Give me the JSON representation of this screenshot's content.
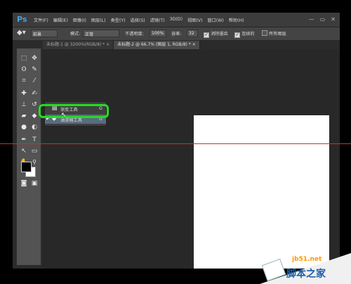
{
  "app": {
    "logo": "Ps"
  },
  "menu": [
    "文件(F)",
    "编辑(E)",
    "图像(I)",
    "图层(L)",
    "类型(Y)",
    "选择(S)",
    "滤镜(T)",
    "3D(D)",
    "视图(V)",
    "窗口(W)",
    "帮助(H)"
  ],
  "window_controls": {
    "minimize": "—",
    "restore": "▭",
    "close": "✕"
  },
  "options": {
    "tool_icon": "paint-bucket-icon",
    "fill_source": "前景",
    "mode_label": "模式:",
    "mode_value": "正常",
    "opacity_label": "不透明度:",
    "opacity_value": "100%",
    "tolerance_label": "容差:",
    "tolerance_value": "32",
    "antialias_label": "消除锯齿",
    "contiguous_label": "连续的",
    "all_layers_label": "所有图层"
  },
  "tabs": [
    {
      "label": "未标题-1 @ 3200%(RGB/8) *",
      "close": "×"
    },
    {
      "label": "未标题-2 @ 66.7% (图层 1, RGB/8) *",
      "close": "×"
    }
  ],
  "flyout": {
    "items": [
      {
        "label": "渐变工具",
        "shortcut": "G",
        "icon": "gradient-icon"
      },
      {
        "label": "油漆桶工具",
        "shortcut": "G",
        "icon": "paint-bucket-icon"
      }
    ]
  },
  "tools": {
    "marquee": "⬚",
    "move": "✥",
    "lasso": "ʘ",
    "quick_select": "✎",
    "crop": "⌗",
    "eyedropper": "⁄",
    "healing": "✚",
    "brush": "✍",
    "stamp": "⊥",
    "history_brush": "↺",
    "eraser": "▰",
    "bucket": "◆",
    "blur": "●",
    "dodge": "◐",
    "pen": "✒",
    "type": "T",
    "path_select": "↖",
    "shape": "▭",
    "hand": "✋",
    "zoom": "🔍",
    "quickmask": "◙",
    "screen_mode": "▣"
  },
  "watermark": {
    "url": "jb51.net",
    "site": "脚本之家"
  },
  "colors": {
    "highlight": "#22dd22",
    "guide_line": "#c83232",
    "canvas": "#ffffff",
    "foreground": "#000000",
    "background": "#ffffff"
  }
}
